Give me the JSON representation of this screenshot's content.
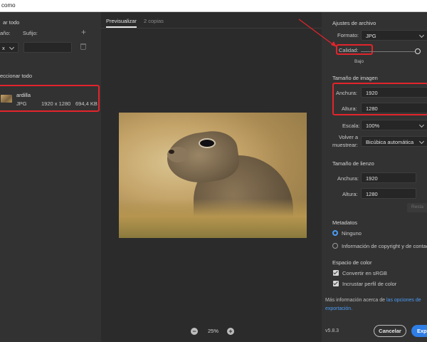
{
  "window": {
    "title": "como"
  },
  "left_panel": {
    "header_partial": "ar todo",
    "size_label_partial": "año:",
    "suffix_label": "Sufijo:",
    "size_value_partial": "x",
    "select_all_partial": "eccionar todo",
    "file": {
      "name": "ardilla",
      "format": "JPG",
      "dimensions": "1920 x 1280",
      "size": "694,4 KB"
    }
  },
  "center": {
    "tabs": [
      {
        "label": "Previsualizar"
      },
      {
        "label": "2 copias"
      }
    ],
    "zoom": "25%",
    "zoom_minus": "−",
    "zoom_plus": "+"
  },
  "right_panel": {
    "file_settings": {
      "title": "Ajustes de archivo",
      "format_label": "Formato:",
      "format_value": "JPG",
      "quality_label": "Calidad:",
      "quality_value_label": "Bajo",
      "quality_level": 1.0
    },
    "image_size": {
      "title": "Tamaño de imagen",
      "width_label": "Anchura:",
      "width_value": "1920",
      "height_label": "Altura:",
      "height_value": "1280",
      "scale_label": "Escala:",
      "scale_value": "100%",
      "resample_label_1": "Volver a",
      "resample_label_2": "muestrear:",
      "resample_value": "Bicúbica automática"
    },
    "canvas_size": {
      "title": "Tamaño de lienzo",
      "width_label": "Anchura:",
      "width_value": "1920",
      "height_label": "Altura:",
      "height_value": "1280",
      "reset_partial": "Resta"
    },
    "metadata": {
      "title": "Metadatos",
      "option_none": "Ninguno",
      "option_copyright": "Información de copyright y de contacto"
    },
    "color_space": {
      "title": "Espacio de color",
      "convert_srgb": "Convertir en sRGB",
      "embed_profile": "Incrustar perfil de color"
    },
    "more_info": {
      "prefix": "Más información acerca de",
      "link_1": "las opciones de",
      "link_2": "exportación."
    },
    "version": "v5.8.3",
    "cancel_label": "Cancelar",
    "export_partial": "Exp"
  },
  "colors": {
    "accent": "#2f7ee6",
    "annotation": "#e3242b",
    "panel": "#323232",
    "preview_bg": "#2b2b2b"
  }
}
